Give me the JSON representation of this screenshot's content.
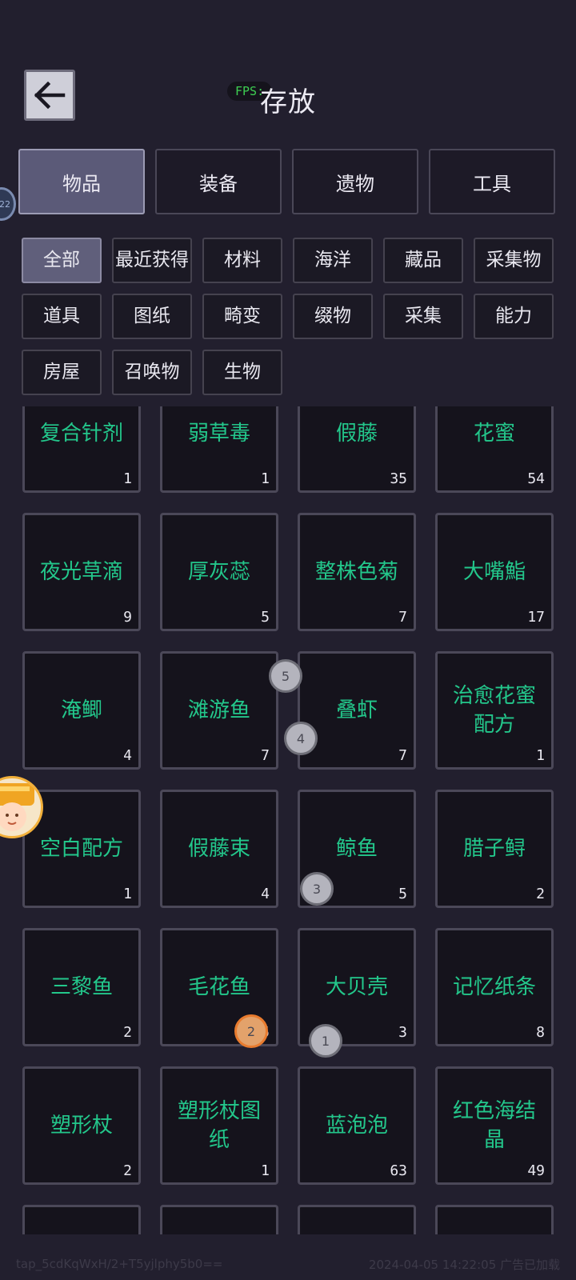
{
  "header": {
    "title": "存放",
    "fps_label": "FPS:",
    "side_badge": "22"
  },
  "tabs": [
    {
      "label": "物品",
      "active": true
    },
    {
      "label": "装备",
      "active": false
    },
    {
      "label": "遗物",
      "active": false
    },
    {
      "label": "工具",
      "active": false
    }
  ],
  "filters": [
    [
      {
        "label": "全部",
        "active": true
      },
      {
        "label": "最近获得",
        "active": false
      },
      {
        "label": "材料",
        "active": false
      },
      {
        "label": "海洋",
        "active": false
      },
      {
        "label": "藏品",
        "active": false
      },
      {
        "label": "采集物",
        "active": false
      }
    ],
    [
      {
        "label": "道具",
        "active": false
      },
      {
        "label": "图纸",
        "active": false
      },
      {
        "label": "畸变",
        "active": false
      },
      {
        "label": "缀物",
        "active": false
      },
      {
        "label": "采集",
        "active": false
      },
      {
        "label": "能力",
        "active": false
      }
    ],
    [
      {
        "label": "房屋",
        "active": false
      },
      {
        "label": "召唤物",
        "active": false
      },
      {
        "label": "生物",
        "active": false
      }
    ]
  ],
  "items": [
    {
      "name": "复合针剂",
      "count": "1"
    },
    {
      "name": "弱草毒",
      "count": "1"
    },
    {
      "name": "假藤",
      "count": "35"
    },
    {
      "name": "花蜜",
      "count": "54"
    },
    {
      "name": "夜光草滴",
      "count": "9"
    },
    {
      "name": "厚灰蕊",
      "count": "5"
    },
    {
      "name": "整株色菊",
      "count": "7"
    },
    {
      "name": "大嘴鮨",
      "count": "17"
    },
    {
      "name": "淹鲫",
      "count": "4"
    },
    {
      "name": "滩游鱼",
      "count": "7"
    },
    {
      "name": "叠虾",
      "count": "7"
    },
    {
      "name": "治愈花蜜配方",
      "count": "1"
    },
    {
      "name": "空白配方",
      "count": "1"
    },
    {
      "name": "假藤束",
      "count": "4"
    },
    {
      "name": "鲸鱼",
      "count": "5"
    },
    {
      "name": "腊子鲟",
      "count": "2"
    },
    {
      "name": "三黎鱼",
      "count": "2"
    },
    {
      "name": "毛花鱼",
      "count": "5"
    },
    {
      "name": "大贝壳",
      "count": "3"
    },
    {
      "name": "记忆纸条",
      "count": "8"
    },
    {
      "name": "塑形杖",
      "count": "2"
    },
    {
      "name": "塑形杖图纸",
      "count": "1"
    },
    {
      "name": "蓝泡泡",
      "count": "63"
    },
    {
      "name": "红色海结晶",
      "count": "49"
    },
    {
      "name": "",
      "count": ""
    },
    {
      "name": "",
      "count": ""
    },
    {
      "name": "",
      "count": ""
    },
    {
      "name": "",
      "count": ""
    }
  ],
  "touch_points": [
    {
      "label": "5",
      "active": false
    },
    {
      "label": "4",
      "active": false
    },
    {
      "label": "3",
      "active": false
    },
    {
      "label": "2",
      "active": true
    },
    {
      "label": "1",
      "active": false
    }
  ],
  "footer": {
    "left": "tap_5cdKqWxH/2+T5yjlphy5b0==",
    "right": "2024-04-05 14:22:05 广告已加载"
  },
  "colors": {
    "accent_text": "#23c78b",
    "background": "#221f2e",
    "active_tab": "#5b5a78"
  }
}
